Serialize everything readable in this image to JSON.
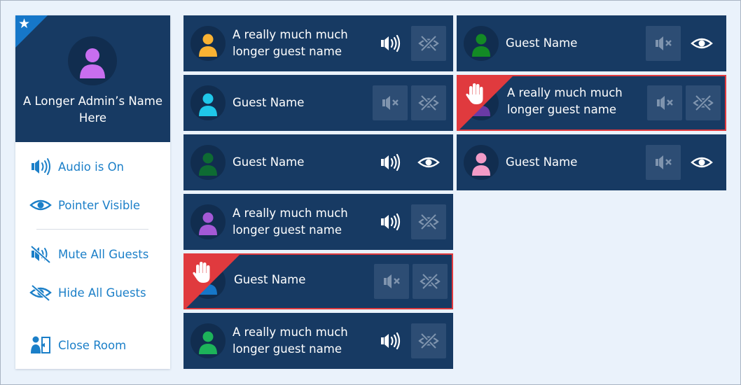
{
  "colors": {
    "panel": "#173a63",
    "button_dim": "#2d4d74",
    "accent_blue": "#1b7fc8",
    "raised_hand": "#e03a3e",
    "background": "#eaf2fb"
  },
  "admin": {
    "name": "A Longer Admin’s Name Here",
    "avatar_color": "#c86ef0",
    "badge_icon": "star-icon",
    "actions": [
      {
        "label": "Audio is On",
        "icon": "speaker-on-icon"
      },
      {
        "label": "Pointer Visible",
        "icon": "eye-icon"
      },
      {
        "label": "Mute All Guests",
        "icon": "speaker-off-icon"
      },
      {
        "label": "Hide All Guests",
        "icon": "eye-off-icon"
      },
      {
        "label": "Close Room",
        "icon": "close-room-icon"
      }
    ]
  },
  "guests": [
    {
      "name": "A really much much longer guest name",
      "avatar_color": "#f9b233",
      "audio": "on",
      "pointer": "hidden",
      "hand_raised": false
    },
    {
      "name": "Guest Name",
      "avatar_color": "#1fc7e9",
      "audio": "muted",
      "pointer": "hidden",
      "hand_raised": false
    },
    {
      "name": "Guest Name",
      "avatar_color": "#0e6b33",
      "audio": "on",
      "pointer": "visible",
      "hand_raised": false
    },
    {
      "name": "A really much much longer guest name",
      "avatar_color": "#a359d6",
      "audio": "on",
      "pointer": "hidden",
      "hand_raised": false
    },
    {
      "name": "Guest Name",
      "avatar_color": "#1677c9",
      "audio": "muted",
      "pointer": "hidden",
      "hand_raised": true
    },
    {
      "name": "A really much much longer guest name",
      "avatar_color": "#1db35a",
      "audio": "on",
      "pointer": "hidden",
      "hand_raised": false
    },
    {
      "name": "Guest Name",
      "avatar_color": "#138a25",
      "audio": "muted",
      "pointer": "visible",
      "hand_raised": false
    },
    {
      "name": "A really much much longer guest name",
      "avatar_color": "#6a3aa6",
      "audio": "muted",
      "pointer": "hidden",
      "hand_raised": true
    },
    {
      "name": "Guest Name",
      "avatar_color": "#f29bc6",
      "audio": "muted",
      "pointer": "visible",
      "hand_raised": false
    }
  ]
}
